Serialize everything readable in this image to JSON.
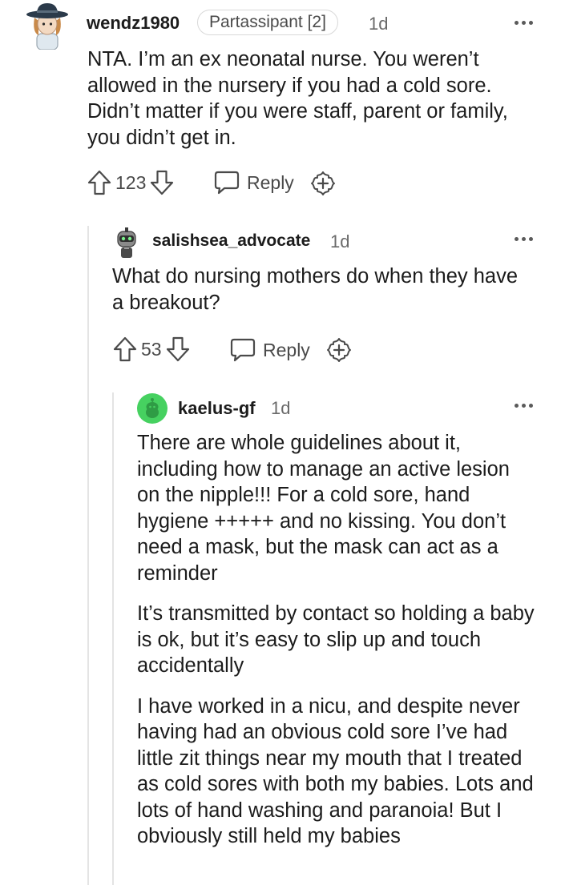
{
  "comments": [
    {
      "username": "wendz1980",
      "flair": "Partassipant [2]",
      "time": "1d",
      "paragraphs": [
        "NTA. I’m an ex neonatal nurse. You weren’t allowed in the nursery if you had a cold sore. Didn’t matter if you were staff, parent or family, you didn’t get in."
      ],
      "votes": "123",
      "reply_label": "Reply",
      "avatar_icon": "hat-avatar-icon"
    },
    {
      "username": "salishsea_advocate",
      "time": "1d",
      "paragraphs": [
        "What do nursing mothers do when they have a breakout?"
      ],
      "votes": "53",
      "reply_label": "Reply",
      "avatar_icon": "robot-avatar-icon"
    },
    {
      "username": "kaelus-gf",
      "time": "1d",
      "paragraphs": [
        "There are whole guidelines about it, including how to manage an active lesion on the nipple!!! For a cold sore, hand hygiene +++++ and no kissing. You don’t need a mask, but the mask can act as a reminder",
        "It’s transmitted by contact so holding a baby is ok, but it’s easy to slip up and touch accidentally",
        "I have worked in a nicu, and despite never having had an obvious cold sore I’ve had little zit things near my mouth that I treated as cold sores with both my babies. Lots and lots of hand washing and paranoia! But I obviously still held my babies"
      ],
      "avatar_icon": "snoo-avatar-icon"
    }
  ],
  "colors": {
    "text": "#1c1c1c",
    "meta": "#6a6a6a",
    "icon": "#4a4a4a",
    "thread_line": "#e4e4e4",
    "snoo_green": "#46d160"
  }
}
